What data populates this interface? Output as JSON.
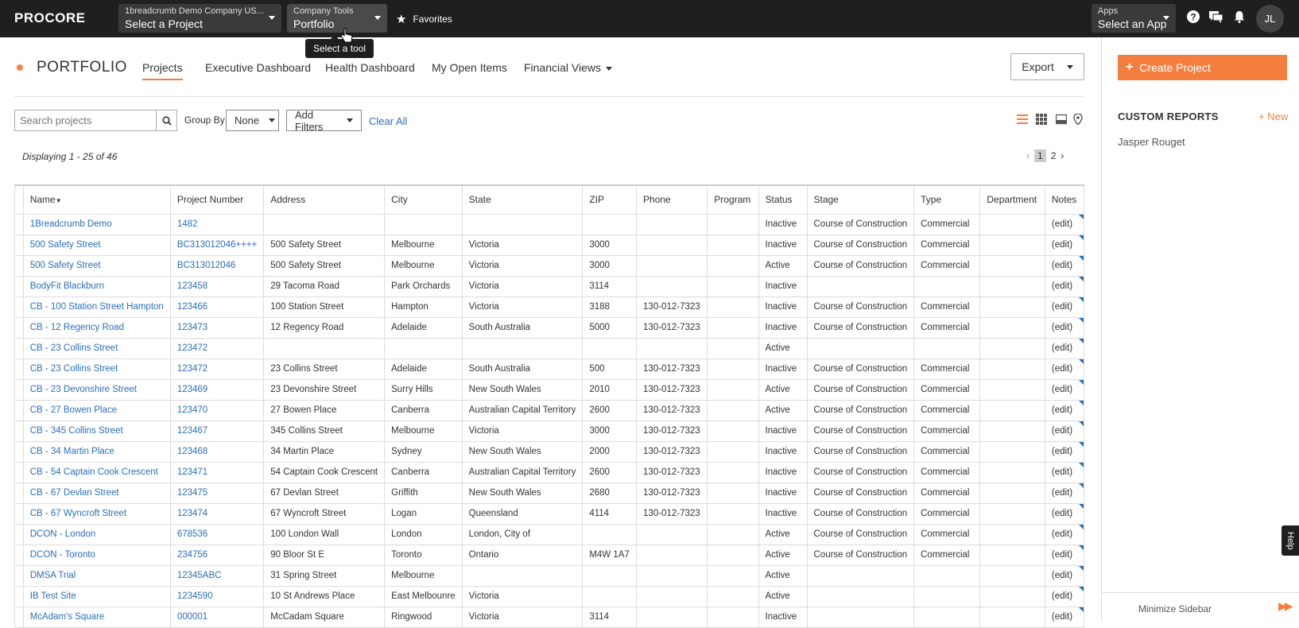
{
  "topbar": {
    "logo": "PROCORE",
    "project_dd": {
      "small": "1breadcrumb Demo Company US...",
      "big": "Select a Project"
    },
    "tools_dd": {
      "small": "Company Tools",
      "big": "Portfolio"
    },
    "favorites": "Favorites",
    "tooltip": "Select a tool",
    "apps_dd": {
      "small": "Apps",
      "big": "Select an App"
    },
    "avatar": "JL"
  },
  "header": {
    "title": "PORTFOLIO",
    "tabs": [
      "Projects",
      "Executive Dashboard",
      "Health Dashboard",
      "My Open Items",
      "Financial Views"
    ],
    "export_label": "Export"
  },
  "filters": {
    "search_placeholder": "Search projects",
    "group_by_label": "Group By:",
    "group_by_value": "None",
    "add_filters": "Add Filters",
    "clear_all": "Clear All",
    "displaying": "Displaying 1 - 25 of 46",
    "pages": [
      "1",
      "2"
    ]
  },
  "table": {
    "headers": [
      "Name",
      "Project Number",
      "Address",
      "City",
      "State",
      "ZIP",
      "Phone",
      "Program",
      "Status",
      "Stage",
      "Type",
      "Department",
      "Notes"
    ],
    "rows": [
      [
        "1Breadcrumb Demo",
        "1482",
        "",
        "",
        "",
        "",
        "",
        "",
        "Inactive",
        "Course of Construction",
        "Commercial",
        "",
        "(edit)"
      ],
      [
        "500 Safety Street",
        "BC313012046++++",
        "500 Safety Street",
        "Melbourne",
        "Victoria",
        "3000",
        "",
        "",
        "Inactive",
        "Course of Construction",
        "Commercial",
        "",
        "(edit)"
      ],
      [
        "500 Safety Street",
        "BC313012046",
        "500 Safety Street",
        "Melbourne",
        "Victoria",
        "3000",
        "",
        "",
        "Active",
        "Course of Construction",
        "Commercial",
        "",
        "(edit)"
      ],
      [
        "BodyFit Blackburn",
        "123458",
        "29 Tacoma Road",
        "Park Orchards",
        "Victoria",
        "3114",
        "",
        "",
        "Inactive",
        "",
        "",
        "",
        "(edit)"
      ],
      [
        "CB - 100 Station Street Hampton",
        "123466",
        "100 Station Street",
        "Hampton",
        "Victoria",
        "3188",
        "130-012-7323",
        "",
        "Inactive",
        "Course of Construction",
        "Commercial",
        "",
        "(edit)"
      ],
      [
        "CB - 12 Regency Road",
        "123473",
        "12 Regency Road",
        "Adelaide",
        "South Australia",
        "5000",
        "130-012-7323",
        "",
        "Inactive",
        "Course of Construction",
        "Commercial",
        "",
        "(edit)"
      ],
      [
        "CB - 23 Collins Street",
        "123472",
        "",
        "",
        "",
        "",
        "",
        "",
        "Active",
        "",
        "",
        "",
        "(edit)"
      ],
      [
        "CB - 23 Collins Street",
        "123472",
        "23 Collins Street",
        "Adelaide",
        "South Australia",
        "500",
        "130-012-7323",
        "",
        "Inactive",
        "Course of Construction",
        "Commercial",
        "",
        "(edit)"
      ],
      [
        "CB - 23 Devonshire Street",
        "123469",
        "23 Devonshire Street",
        "Surry Hills",
        "New South Wales",
        "2010",
        "130-012-7323",
        "",
        "Active",
        "Course of Construction",
        "Commercial",
        "",
        "(edit)"
      ],
      [
        "CB - 27 Bowen Place",
        "123470",
        "27 Bowen Place",
        "Canberra",
        "Australian Capital Territory",
        "2600",
        "130-012-7323",
        "",
        "Active",
        "Course of Construction",
        "Commercial",
        "",
        "(edit)"
      ],
      [
        "CB - 345 Collins Street",
        "123467",
        "345 Collins Street",
        "Melbourne",
        "Victoria",
        "3000",
        "130-012-7323",
        "",
        "Inactive",
        "Course of Construction",
        "Commercial",
        "",
        "(edit)"
      ],
      [
        "CB - 34 Martin Place",
        "123468",
        "34 Martin Place",
        "Sydney",
        "New South Wales",
        "2000",
        "130-012-7323",
        "",
        "Inactive",
        "Course of Construction",
        "Commercial",
        "",
        "(edit)"
      ],
      [
        "CB - 54 Captain Cook Crescent",
        "123471",
        "54 Captain Cook Crescent",
        "Canberra",
        "Australian Capital Territory",
        "2600",
        "130-012-7323",
        "",
        "Inactive",
        "Course of Construction",
        "Commercial",
        "",
        "(edit)"
      ],
      [
        "CB - 67 Devlan Street",
        "123475",
        "67 Devlan Street",
        "Griffith",
        "New South Wales",
        "2680",
        "130-012-7323",
        "",
        "Inactive",
        "Course of Construction",
        "Commercial",
        "",
        "(edit)"
      ],
      [
        "CB - 67 Wyncroft Street",
        "123474",
        "67 Wyncroft Street",
        "Logan",
        "Queensland",
        "4114",
        "130-012-7323",
        "",
        "Inactive",
        "Course of Construction",
        "Commercial",
        "",
        "(edit)"
      ],
      [
        "DCON - London",
        "678536",
        "100 London Wall",
        "London",
        "London, City of",
        "",
        "",
        "",
        "Active",
        "Course of Construction",
        "Commercial",
        "",
        "(edit)"
      ],
      [
        "DCON - Toronto",
        "234756",
        "90 Bloor St E",
        "Toronto",
        "Ontario",
        "M4W 1A7",
        "",
        "",
        "Active",
        "Course of Construction",
        "Commercial",
        "",
        "(edit)"
      ],
      [
        "DMSA Trial",
        "12345ABC",
        "31 Spring Street",
        "Melbourne",
        "",
        "",
        "",
        "",
        "Active",
        "",
        "",
        "",
        "(edit)"
      ],
      [
        "IB Test Site",
        "1234590",
        "10 St Andrews Place",
        "East Melbounre",
        "Victoria",
        "",
        "",
        "",
        "Active",
        "",
        "",
        "",
        "(edit)"
      ],
      [
        "McAdam's Square",
        "000001",
        "McCadam Square",
        "Ringwood",
        "Victoria",
        "3114",
        "",
        "",
        "Inactive",
        "",
        "",
        "",
        "(edit)"
      ]
    ]
  },
  "sidebar": {
    "create_project": "Create Project",
    "custom_reports": "CUSTOM REPORTS",
    "new_label": "+ New",
    "reports": [
      "Jasper Rouget"
    ],
    "minimize": "Minimize Sidebar",
    "help": "Help"
  },
  "colors": {
    "accent": "#f47e3e",
    "link": "#2a6ebb",
    "topbar": "#1f1f1f"
  }
}
